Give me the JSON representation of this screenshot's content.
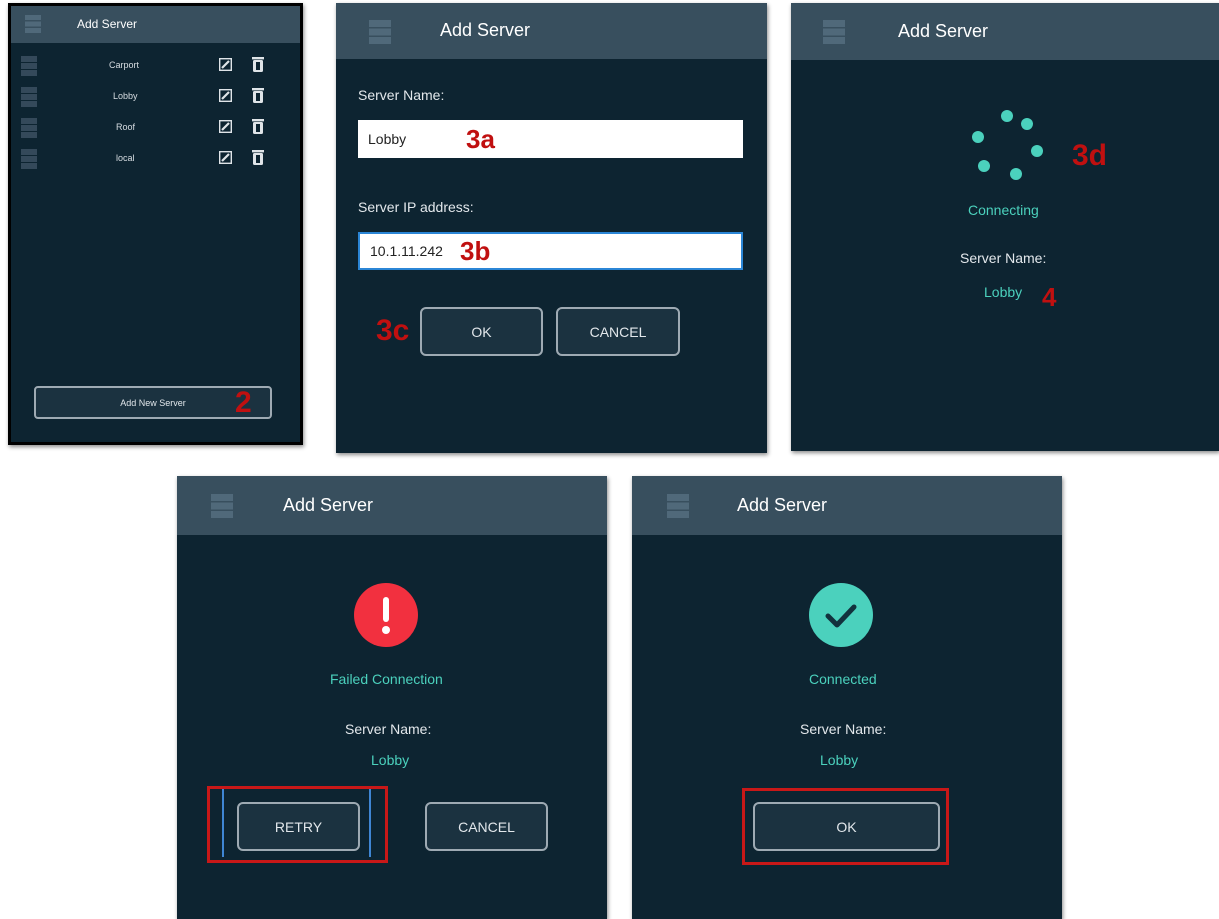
{
  "colors": {
    "panel_bg": "#0d2431",
    "header_bg": "#384f5e",
    "accent_teal": "#4bd1bd",
    "error_red": "#f2303f",
    "annotation_red": "#c01010"
  },
  "panel1": {
    "title": "Add Server",
    "servers": [
      {
        "name": "Carport"
      },
      {
        "name": "Lobby"
      },
      {
        "name": "Roof"
      },
      {
        "name": "local"
      }
    ],
    "add_button_label": "Add New Server",
    "annotation": "2"
  },
  "panel2": {
    "title": "Add Server",
    "name_label": "Server Name:",
    "name_value": "Lobby",
    "ip_label": "Server IP address:",
    "ip_value": "10.1.11.242",
    "ok_label": "OK",
    "cancel_label": "CANCEL",
    "annot_name": "3a",
    "annot_ip": "3b",
    "annot_ok": "3c"
  },
  "panel3": {
    "title": "Add Server",
    "status": "Connecting",
    "name_label": "Server Name:",
    "name_value": "Lobby",
    "annot_spinner": "3d",
    "annot_name": "4"
  },
  "panel4": {
    "title": "Add Server",
    "status": "Failed Connection",
    "name_label": "Server Name:",
    "name_value": "Lobby",
    "retry_label": "RETRY",
    "cancel_label": "CANCEL"
  },
  "panel5": {
    "title": "Add Server",
    "status": "Connected",
    "name_label": "Server Name:",
    "name_value": "Lobby",
    "ok_label": "OK"
  }
}
